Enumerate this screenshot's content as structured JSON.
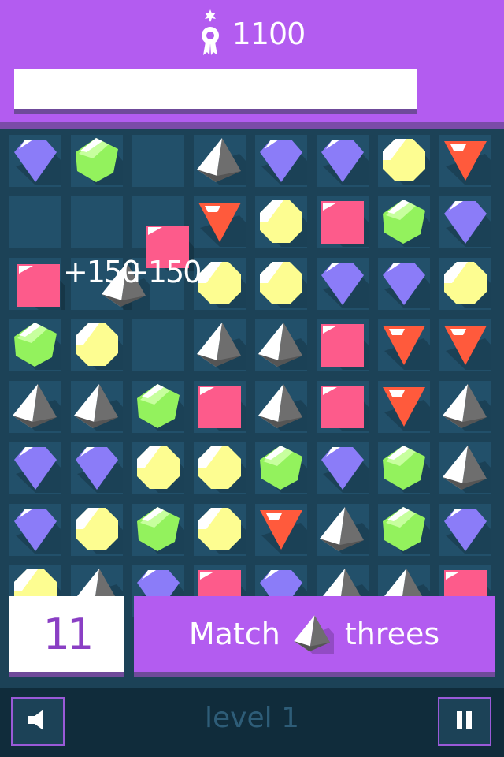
{
  "header": {
    "score": "1100",
    "score_icon": "award-ribbon-icon",
    "progress_fraction": 1.0
  },
  "board": {
    "rows": 8,
    "cols": 8,
    "grid": [
      [
        "blue",
        "green",
        "",
        "gray",
        "blue",
        "blue",
        "yellow",
        "red"
      ],
      [
        "",
        "",
        "",
        "red",
        "yellow",
        "pink",
        "green",
        "blue"
      ],
      [
        "",
        "",
        "",
        "yellow",
        "yellow",
        "blue",
        "blue",
        "yellow"
      ],
      [
        "green",
        "yellow",
        "",
        "gray",
        "gray",
        "pink",
        "red",
        "red"
      ],
      [
        "gray",
        "gray",
        "green",
        "pink",
        "gray",
        "pink",
        "red",
        "gray"
      ],
      [
        "blue",
        "blue",
        "yellow",
        "yellow",
        "green",
        "blue",
        "green",
        "gray"
      ],
      [
        "blue",
        "yellow",
        "green",
        "yellow",
        "red",
        "gray",
        "green",
        "blue"
      ],
      [
        "yellow",
        "gray",
        "blue",
        "pink",
        "blue",
        "gray",
        "gray",
        "pink"
      ]
    ],
    "falling_gems": [
      {
        "type": "pink",
        "row": 1.4,
        "col": 2.15
      },
      {
        "type": "pink",
        "row": 2.03,
        "col": 0.05
      },
      {
        "type": "gray",
        "row": 2.03,
        "col": 1.45
      }
    ],
    "popups": [
      "+150",
      "+150"
    ]
  },
  "colors": {
    "blue": "#8b7cf8",
    "green": "#93f25d",
    "yellow": "#fdfd91",
    "red": "#ff5a3c",
    "pink": "#fd5b8b",
    "gray": "#6e6e6e",
    "header": "#b35cf0",
    "board_bg": "#1c4257",
    "cell": "#22506a"
  },
  "moves": {
    "value": "11"
  },
  "goal": {
    "prefix": "Match",
    "gem": "gray",
    "suffix": "threes"
  },
  "footer": {
    "level_label": "level 1",
    "sound_icon": "speaker-icon",
    "pause_icon": "pause-icon"
  }
}
